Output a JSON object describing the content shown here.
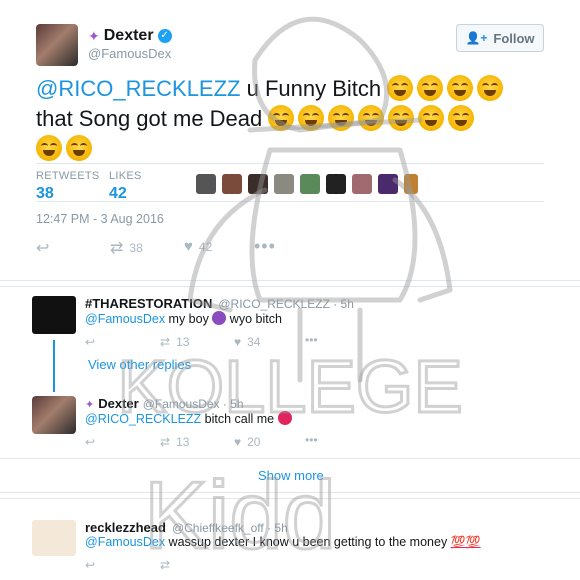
{
  "tweet": {
    "display_name": "Dexter",
    "handle": "@FamousDex",
    "follow_label": "Follow",
    "mention": "@RICO_RECKLEZZ",
    "text_1": " u Funny Bitch ",
    "text_2": "that Song got me Dead ",
    "retweets_label": "RETWEETS",
    "retweets": "38",
    "likes_label": "LIKES",
    "likes": "42",
    "timestamp": "12:47 PM - 3 Aug 2016",
    "action_retweets": "38",
    "action_likes": "42"
  },
  "replies": [
    {
      "display_name": "#THARESTORATION",
      "handle": "@RICO_RECKLEZZ · 5h",
      "mention": "@FamousDex",
      "text": " my boy ",
      "text_after": " wyo bitch",
      "retweets": "13",
      "likes": "34"
    },
    {
      "view_other": "View other replies"
    },
    {
      "display_name": "Dexter",
      "handle": "@FamousDex · 5h",
      "mention": "@RICO_RECKLEZZ",
      "text": " bitch call me ",
      "retweets": "13",
      "likes": "20"
    },
    {
      "show_more": "Show more"
    },
    {
      "display_name": "recklezzhead",
      "handle": "@Chieffkeefk_off · 5h",
      "mention": "@FamousDex",
      "text": " wassup dexter I know u been getting to the money ",
      "hundred": "💯💯"
    }
  ],
  "watermark": {
    "text_1": "KOLLEGE",
    "text_2": "Kidd"
  },
  "colors": {
    "link": "#1b95e0",
    "muted": "#8899a6"
  }
}
